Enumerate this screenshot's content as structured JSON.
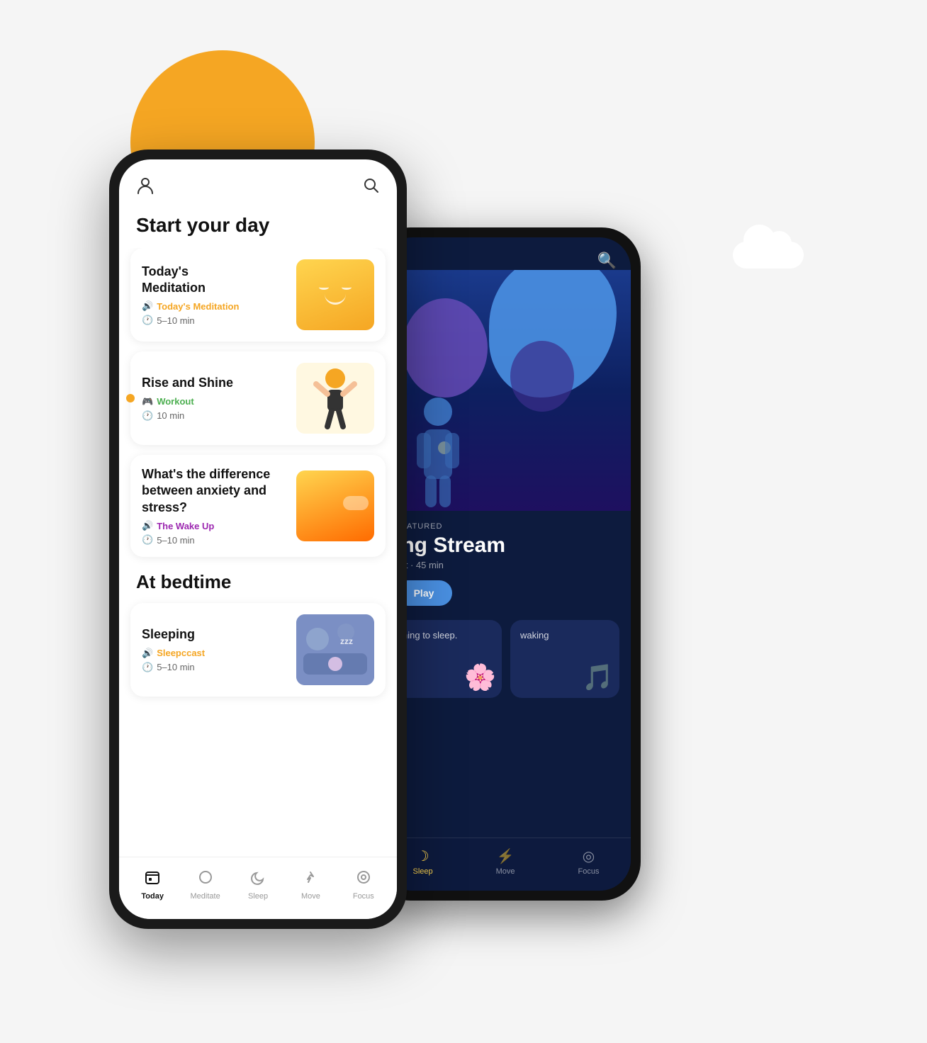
{
  "scene": {
    "background": "#f5f5f5"
  },
  "sun": {
    "color": "#F5A623"
  },
  "front_phone": {
    "header": {
      "person_icon": "👤",
      "search_icon": "🔍"
    },
    "section_start": "Start your day",
    "cards": [
      {
        "title": "Today's\nMeditation",
        "category": "Today's Meditation",
        "category_color": "orange",
        "category_icon": "🔊",
        "duration": "5–10 min",
        "image_type": "meditation"
      },
      {
        "title": "Rise and Shine",
        "category": "Workout",
        "category_color": "green",
        "category_icon": "🎮",
        "duration": "10 min",
        "image_type": "workout"
      },
      {
        "title": "What's the difference between anxiety and stress?",
        "category": "The Wake Up",
        "category_color": "purple",
        "category_icon": "🔊",
        "duration": "5–10 min",
        "image_type": "anxiety"
      }
    ],
    "section_bedtime": "At bedtime",
    "bedtime_cards": [
      {
        "title": "Sleeping",
        "category": "Sleepccast",
        "category_color": "orange",
        "category_icon": "🔊",
        "duration": "5–10 min",
        "image_type": "sleeping"
      }
    ],
    "nav": [
      {
        "label": "Today",
        "icon": "⊞",
        "active": true
      },
      {
        "label": "Meditate",
        "icon": "○",
        "active": false
      },
      {
        "label": "Sleep",
        "icon": "☽",
        "active": false
      },
      {
        "label": "Move",
        "icon": "♲",
        "active": false
      },
      {
        "label": "Focus",
        "icon": "◎",
        "active": false
      }
    ]
  },
  "back_phone": {
    "search_icon": "🔍",
    "featured_label": "Featured",
    "featured_title": "ing Stream",
    "featured_sub": "ast · 45 min",
    "play_label": "Play",
    "sleep_card1_text": "ning to sleep.",
    "sleep_card2_text": "waking",
    "nav": [
      {
        "label": "Sleep",
        "icon": "☽",
        "active": true
      },
      {
        "label": "Move",
        "icon": "♲",
        "active": false
      },
      {
        "label": "Focus",
        "icon": "◎",
        "active": false
      }
    ]
  }
}
